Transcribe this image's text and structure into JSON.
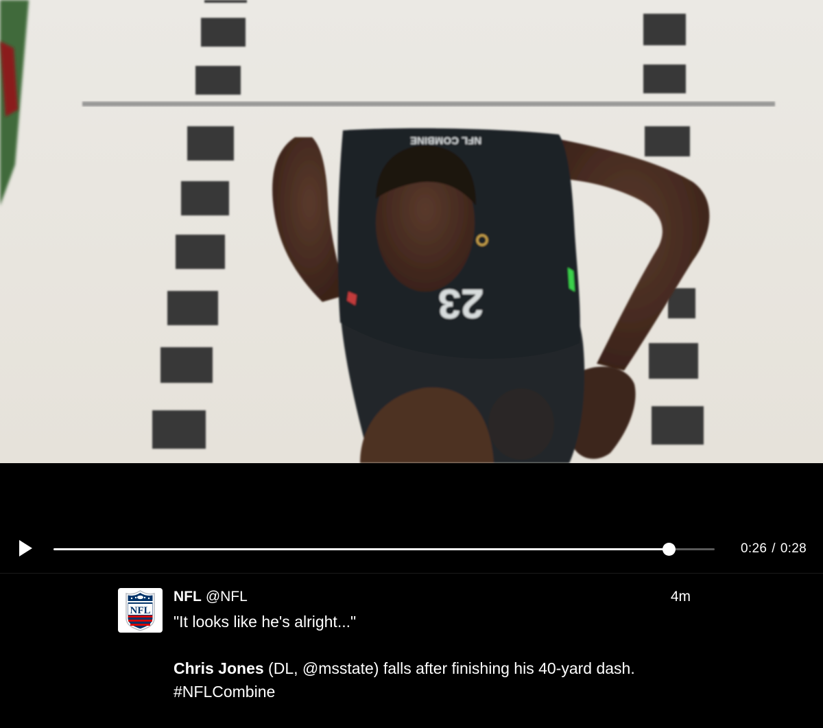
{
  "video": {
    "jersey_number": "23",
    "shirt_text": "NFL COMBINE"
  },
  "player_controls": {
    "play_icon": "play-icon",
    "current_time": "0:26",
    "separator": "/",
    "duration": "0:28",
    "progress": 0.93
  },
  "tweet": {
    "avatar_icon": "nfl-logo",
    "author_name": "NFL",
    "author_handle": "@NFL",
    "time_ago": "4m",
    "quote_line": "\"It looks like he's alright...\"",
    "player_name": "Chris Jones",
    "text_part1": " (DL, ",
    "mention": "@msstate",
    "text_part2": ") falls after finishing his 40-yard dash. ",
    "hashtag": "#NFLCombine"
  },
  "colors": {
    "background": "#000000",
    "turf": "#e9e6df",
    "yard_marks": "#3a3a3a",
    "jersey": "#1f2326",
    "skin": "#4a2e22",
    "nfl_blue": "#013369",
    "nfl_red": "#d50a0a"
  }
}
